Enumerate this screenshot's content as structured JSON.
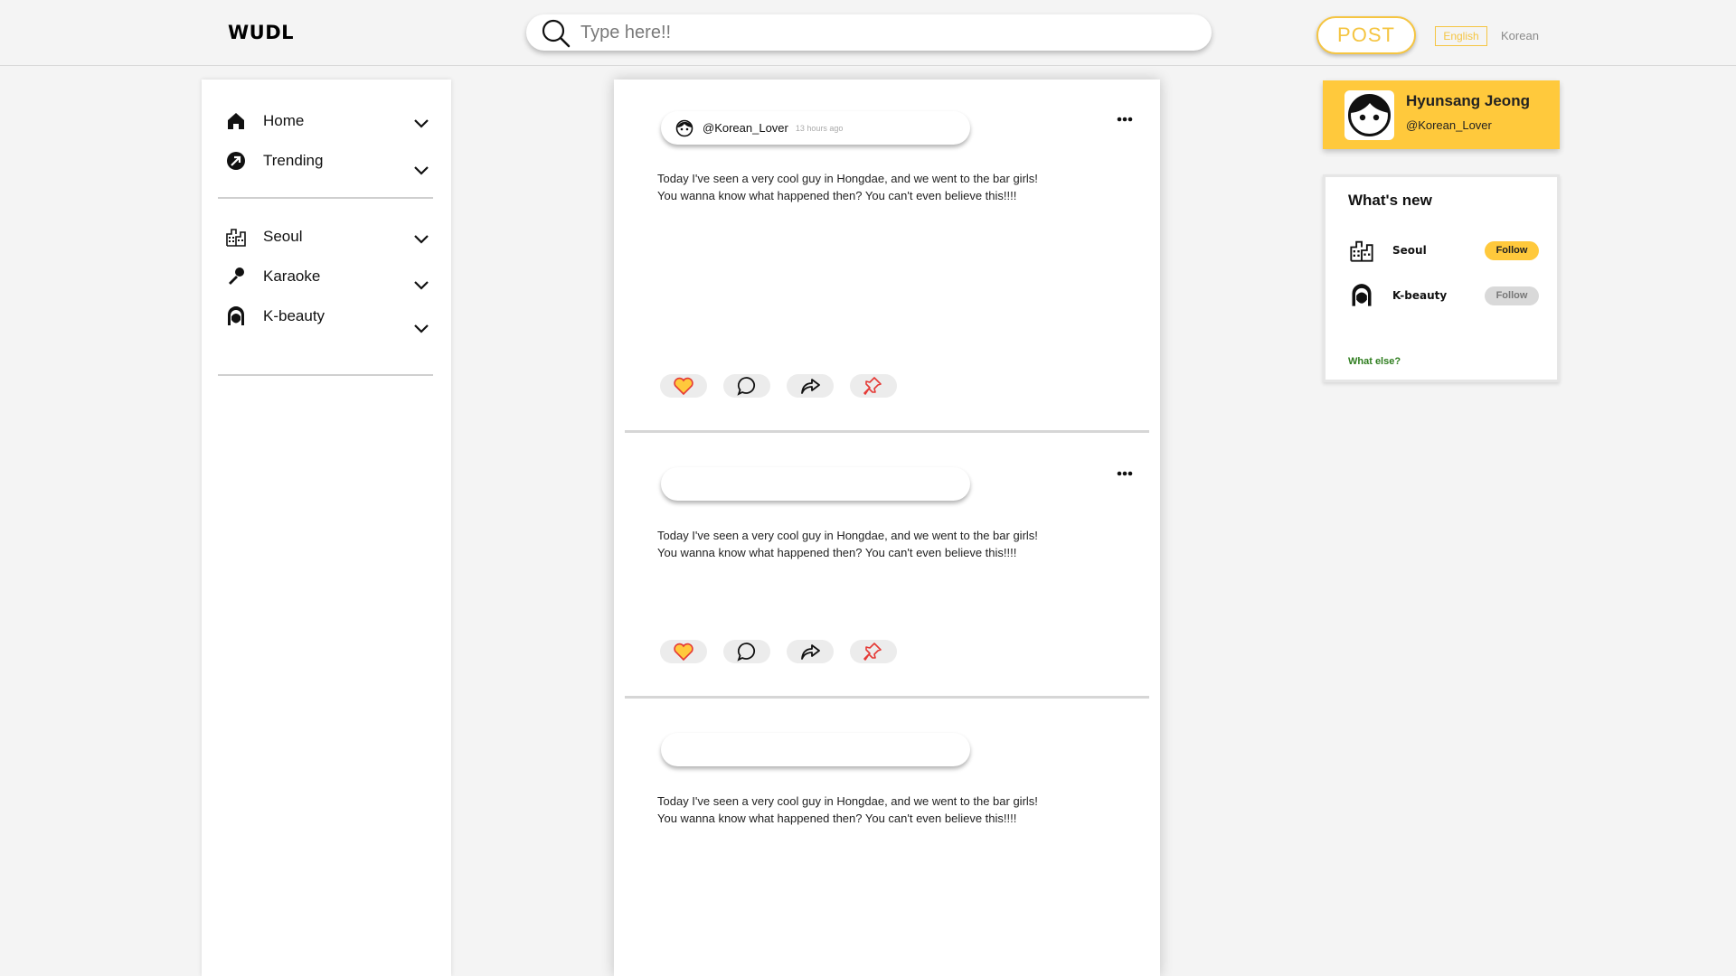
{
  "header": {
    "logo": "WUDL",
    "search_placeholder": "Type here!!",
    "post_label": "POST",
    "lang_english": "English",
    "lang_korean": "Korean"
  },
  "sidebar": {
    "items": [
      {
        "label": "Home",
        "icon": "home-icon"
      },
      {
        "label": "Trending",
        "icon": "trending-icon"
      },
      {
        "label": "Seoul",
        "icon": "city-icon"
      },
      {
        "label": "Karaoke",
        "icon": "microphone-icon"
      },
      {
        "label": "K-beauty",
        "icon": "face-icon"
      }
    ]
  },
  "feed": {
    "posts": [
      {
        "handle": "@Korean_Lover",
        "time": "13 hours ago",
        "line1": "Today I've seen a very cool guy in Hongdae, and we went to the bar girls!",
        "line2": "You wanna know what happened then? You can't even believe this!!!!"
      },
      {
        "handle": "",
        "time": "",
        "line1": "Today I've seen a very cool guy in Hongdae, and we went to the bar girls!",
        "line2": "You wanna know what happened then? You can't even believe this!!!!"
      },
      {
        "handle": "",
        "time": "",
        "line1": "Today I've seen a very cool guy in Hongdae, and we went to the bar girls!",
        "line2": "You wanna know what happened then? You can't even believe this!!!!"
      }
    ]
  },
  "profile": {
    "name": "Hyunsang Jeong",
    "handle": "@Korean_Lover"
  },
  "whats_new": {
    "title": "What's new",
    "topics": [
      {
        "name": "Seoul",
        "follow_label": "Follow",
        "following": true
      },
      {
        "name": "K-beauty",
        "follow_label": "Follow",
        "following": false
      }
    ],
    "more_link": "What else?"
  },
  "colors": {
    "accent": "#ffc93c",
    "post_button": "#f5c542",
    "link_green": "#2e7d1e",
    "pin_red": "#e53935"
  }
}
